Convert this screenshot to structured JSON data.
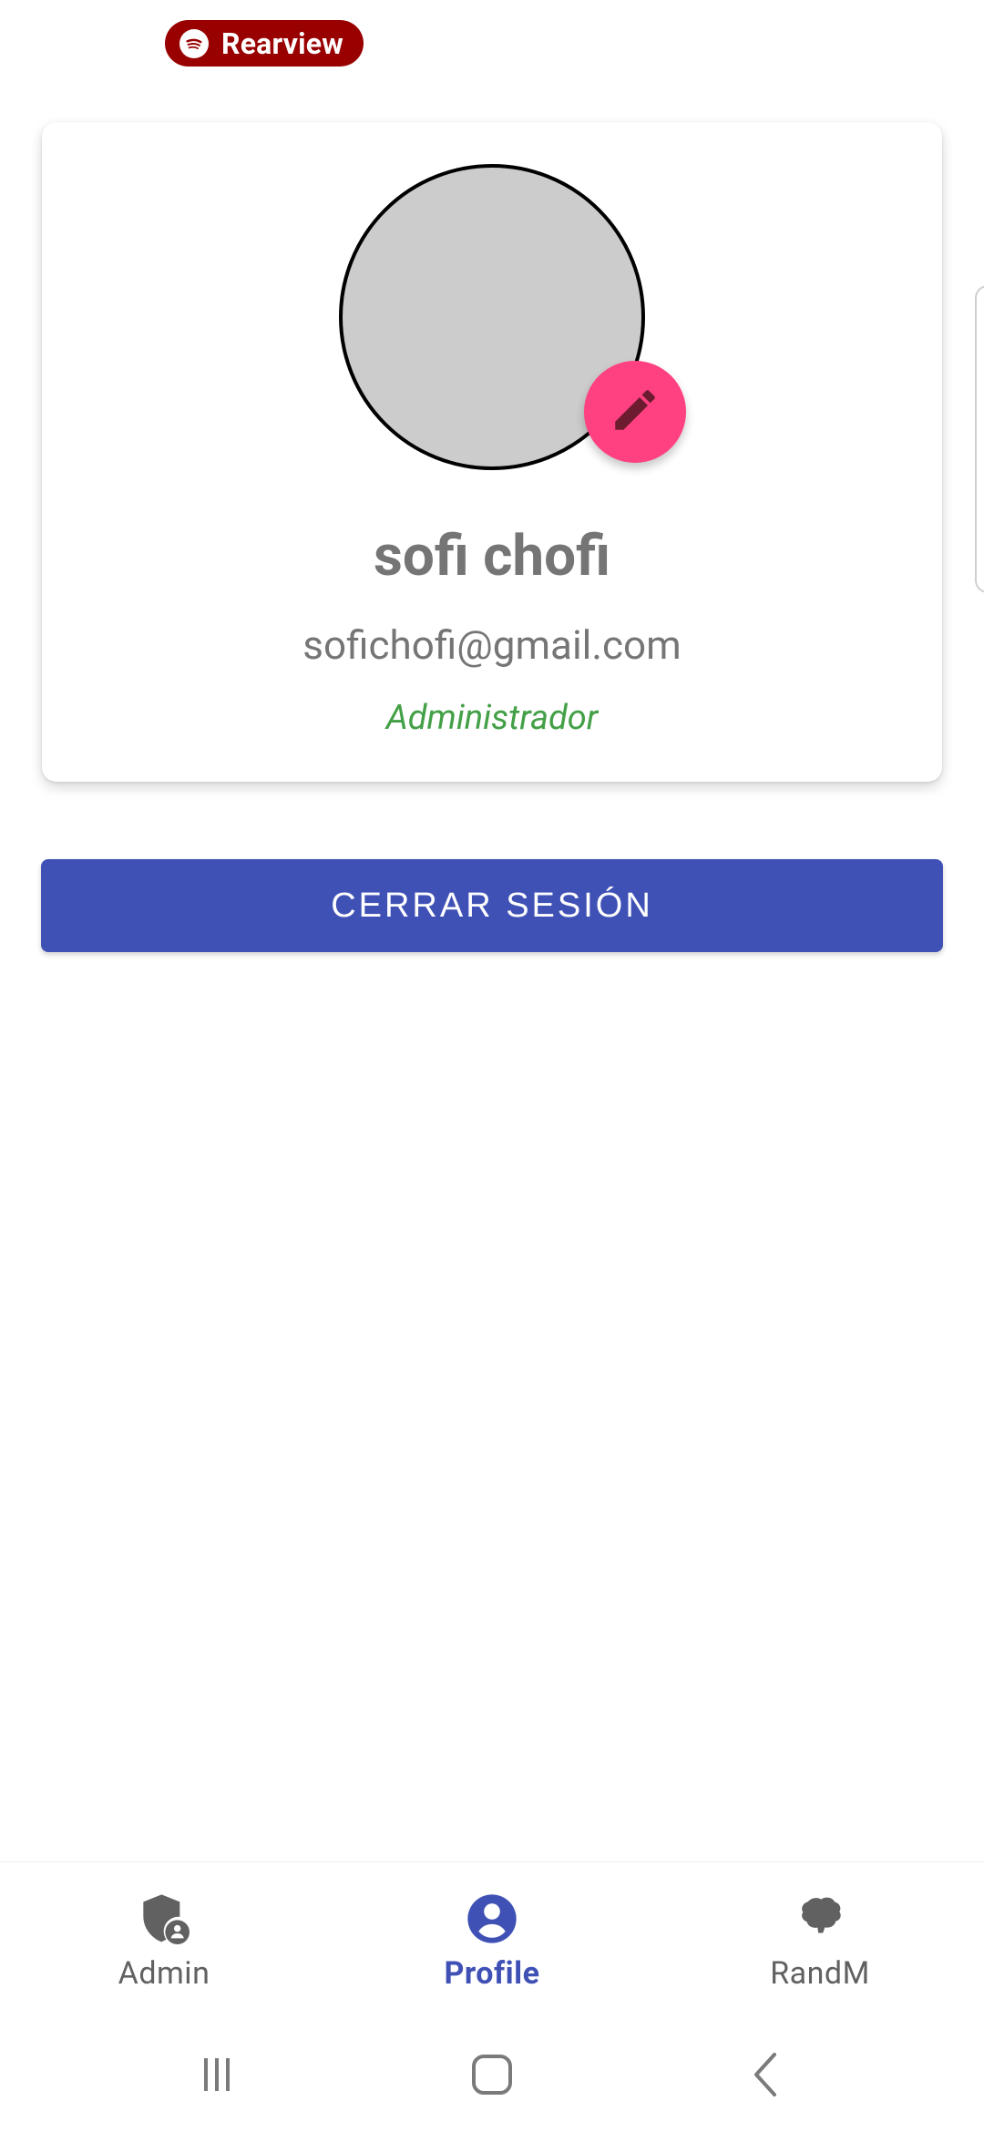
{
  "status_pill": {
    "label": "Rearview",
    "color": "#990000"
  },
  "profile_card": {
    "name": "sofi chofi",
    "email": "sofichofi@gmail.com",
    "role": "Administrador",
    "avatar_color": "#cccccc",
    "edit_icon": "pencil-icon",
    "edit_button_color": "#ff4081",
    "role_color": "#43a047"
  },
  "logout_button": {
    "label": "CERRAR SESIÓN",
    "color": "#3f51b5"
  },
  "bottom_nav": {
    "items": [
      {
        "label": "Admin",
        "icon": "admin-shield-icon",
        "active": false
      },
      {
        "label": "Profile",
        "icon": "account-circle-icon",
        "active": true
      },
      {
        "label": "RandM",
        "icon": "randm-icon",
        "active": false
      }
    ],
    "active_color": "#3f51b5"
  },
  "system_nav": {
    "buttons": [
      "recent-apps-icon",
      "home-icon",
      "back-icon"
    ]
  }
}
